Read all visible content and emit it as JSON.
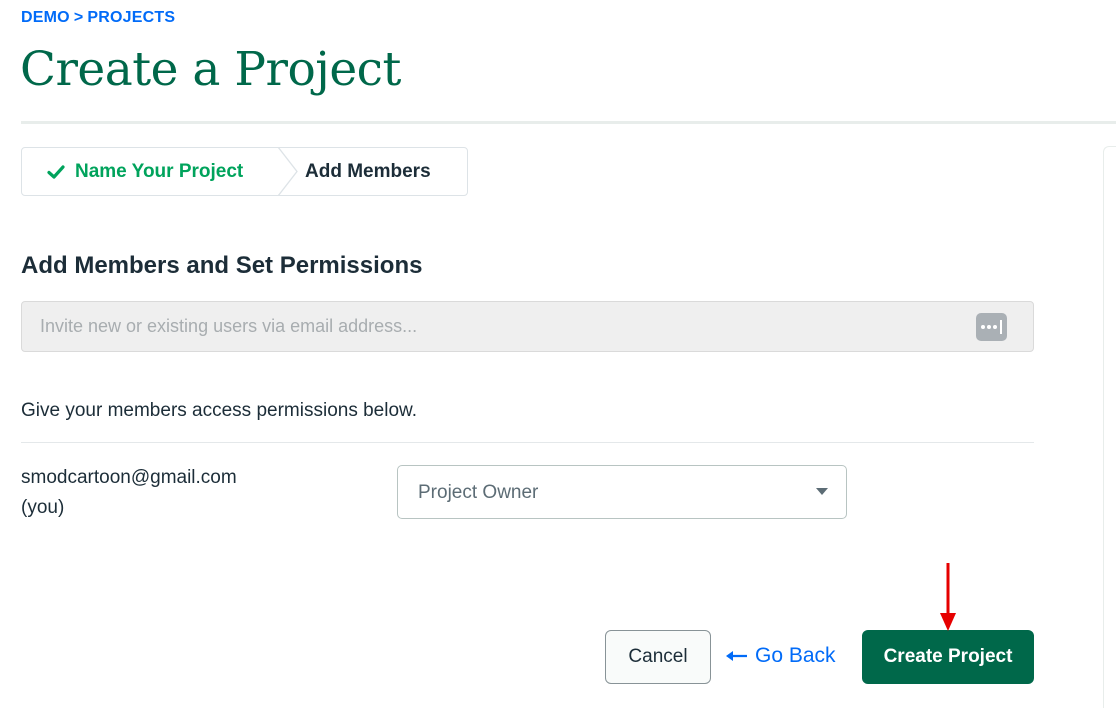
{
  "breadcrumb": {
    "org": "DEMO",
    "separator": ">",
    "section": "PROJECTS"
  },
  "page_title": "Create a Project",
  "stepper": {
    "steps": [
      {
        "label": "Name Your Project",
        "state": "completed",
        "icon": "check-icon"
      },
      {
        "label": "Add Members",
        "state": "active"
      }
    ]
  },
  "members_section": {
    "title": "Add Members and Set Permissions",
    "invite_placeholder": "Invite new or existing users via email address...",
    "invite_value": "",
    "permissions_text": "Give your members access permissions below.",
    "members": [
      {
        "email": "smodcartoon@gmail.com",
        "note": "(you)",
        "role": "Project Owner"
      }
    ]
  },
  "actions": {
    "cancel_label": "Cancel",
    "go_back_label": "Go Back",
    "create_label": "Create Project"
  },
  "colors": {
    "brand_green": "#00684a",
    "completed_green": "#00a35c",
    "link_blue": "#016bf8",
    "annotation_red": "#e60000"
  }
}
